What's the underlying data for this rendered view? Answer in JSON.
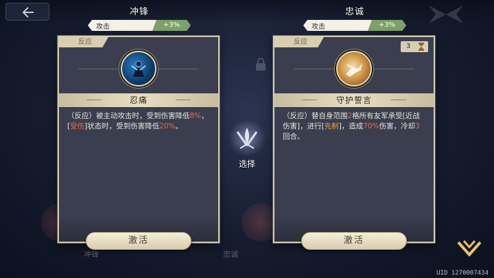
{
  "left": {
    "name": "冲锋",
    "stat_label": "攻击",
    "stat_bonus": "+3%",
    "tag": "反应",
    "skill_title": "忍痛",
    "desc_parts": [
      "（反应）被主动攻击时，受到伤害降低",
      "8%",
      "，[",
      "受伤",
      "]状态时，受到伤害降低",
      "20%",
      "。"
    ],
    "button": "激活"
  },
  "right": {
    "name": "忠诚",
    "stat_label": "攻击",
    "stat_bonus": "+3%",
    "tag": "反应",
    "counter": "3",
    "skill_title": "守护誓言",
    "desc_parts": [
      "（反应）替自身范围",
      "2",
      "格所有友军承受[近战伤害]，进行[",
      "先制",
      "]，造成",
      "70%",
      "伤害，冷却",
      "3",
      "回合。"
    ],
    "button": "激活"
  },
  "center": {
    "select_label": "选择"
  },
  "background_labels": {
    "left": "冲锋",
    "right": "忠诚"
  },
  "uid": "UID 1270007434",
  "colors": {
    "card_bg": "#3a3e4f",
    "card_border": "#d6ccb0",
    "bonus_green": "#7ea06a",
    "highlight_red": "#e66a4a",
    "highlight_orange": "#f0a040"
  },
  "icons": {
    "back": "back-arrow-icon",
    "left_skill": "wounded-warrior-icon",
    "right_skill": "charging-knight-icon",
    "counter": "hourglass-icon",
    "select": "crossed-swords-leaf-icon",
    "confirm": "chevron-down-icon"
  }
}
